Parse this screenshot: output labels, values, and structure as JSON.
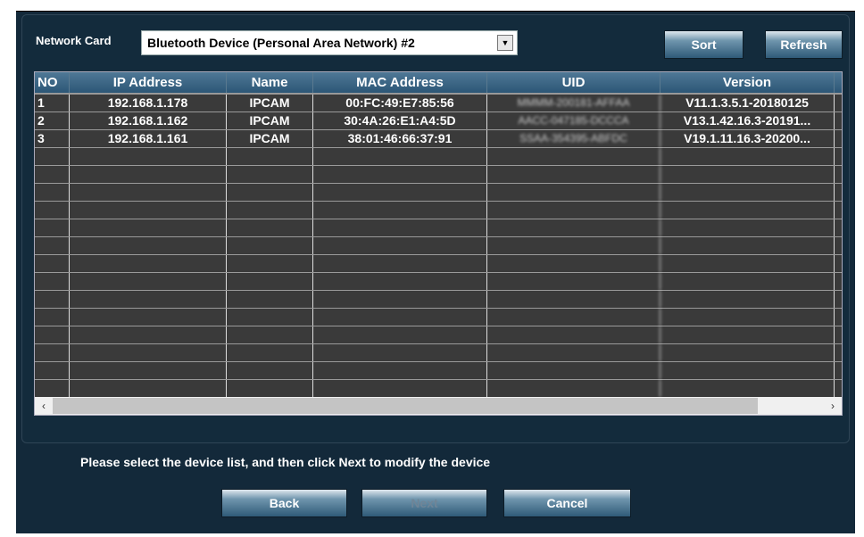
{
  "network_card": {
    "label": "Network Card",
    "value": "Bluetooth Device (Personal Area Network) #2"
  },
  "buttons": {
    "sort": "Sort",
    "refresh": "Refresh",
    "back": "Back",
    "next": "Next",
    "cancel": "Cancel"
  },
  "table": {
    "headers": [
      "NO",
      "IP Address",
      "Name",
      "MAC Address",
      "UID",
      "Version"
    ],
    "rows": [
      [
        "1",
        "192.168.1.178",
        "IPCAM",
        "00:FC:49:E7:85:56",
        "MMMM-200181-AFFAA",
        "V11.1.3.5.1-20180125"
      ],
      [
        "2",
        "192.168.1.162",
        "IPCAM",
        "30:4A:26:E1:A4:5D",
        "AACC-047185-DCCCA",
        "V13.1.42.16.3-20191..."
      ],
      [
        "3",
        "192.168.1.161",
        "IPCAM",
        "38:01:46:66:37:91",
        "SSAA-354395-ABFDC",
        "V19.1.11.16.3-20200..."
      ]
    ]
  },
  "scrollbar": {
    "left": "‹",
    "right": "›"
  },
  "message": "Please select the device list, and then click Next to modify the device"
}
